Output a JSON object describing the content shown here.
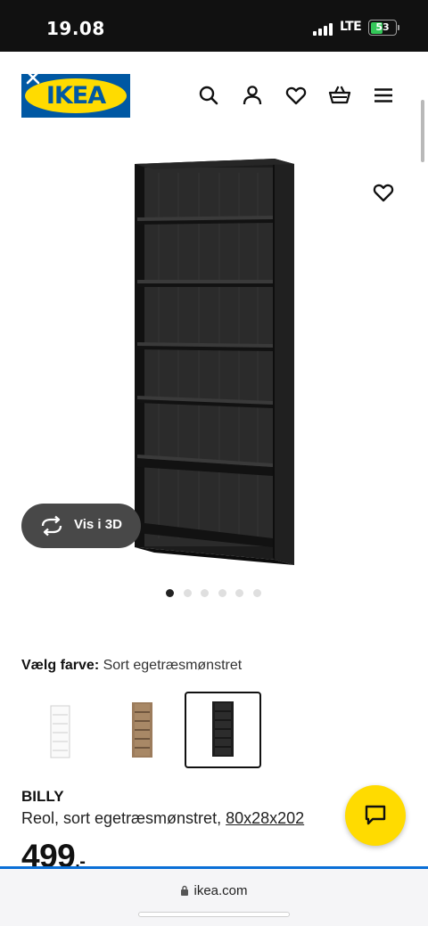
{
  "status_bar": {
    "time": "19.08",
    "network": "LTE",
    "battery": "53",
    "battery_fraction": 0.53
  },
  "header": {
    "logo_text": "IKEA",
    "icons": [
      "search-icon",
      "profile-icon",
      "heart-icon",
      "basket-icon",
      "menu-icon"
    ]
  },
  "gallery": {
    "view_3d_label": "Vis i 3D",
    "image_count": 6,
    "active_index": 0
  },
  "color_picker": {
    "label": "Vælg farve:",
    "selected": "Sort egetræsmønstret",
    "options": [
      {
        "name": "hvid",
        "color": "#f2f2f2"
      },
      {
        "name": "egetræsmønstret",
        "color": "#9c7c5c"
      },
      {
        "name": "sort egetræsmønstret",
        "color": "#262626"
      }
    ],
    "selected_index": 2
  },
  "product": {
    "name": "BILLY",
    "description": "Reol, sort egetræsmønstret, ",
    "size": "80x28x202",
    "price": "499",
    "price_suffix": ".-"
  },
  "browser": {
    "url": "ikea.com"
  },
  "colors": {
    "ikea_blue": "#0058a3",
    "ikea_yellow": "#ffdb00",
    "shelf_dark": "#262626"
  }
}
